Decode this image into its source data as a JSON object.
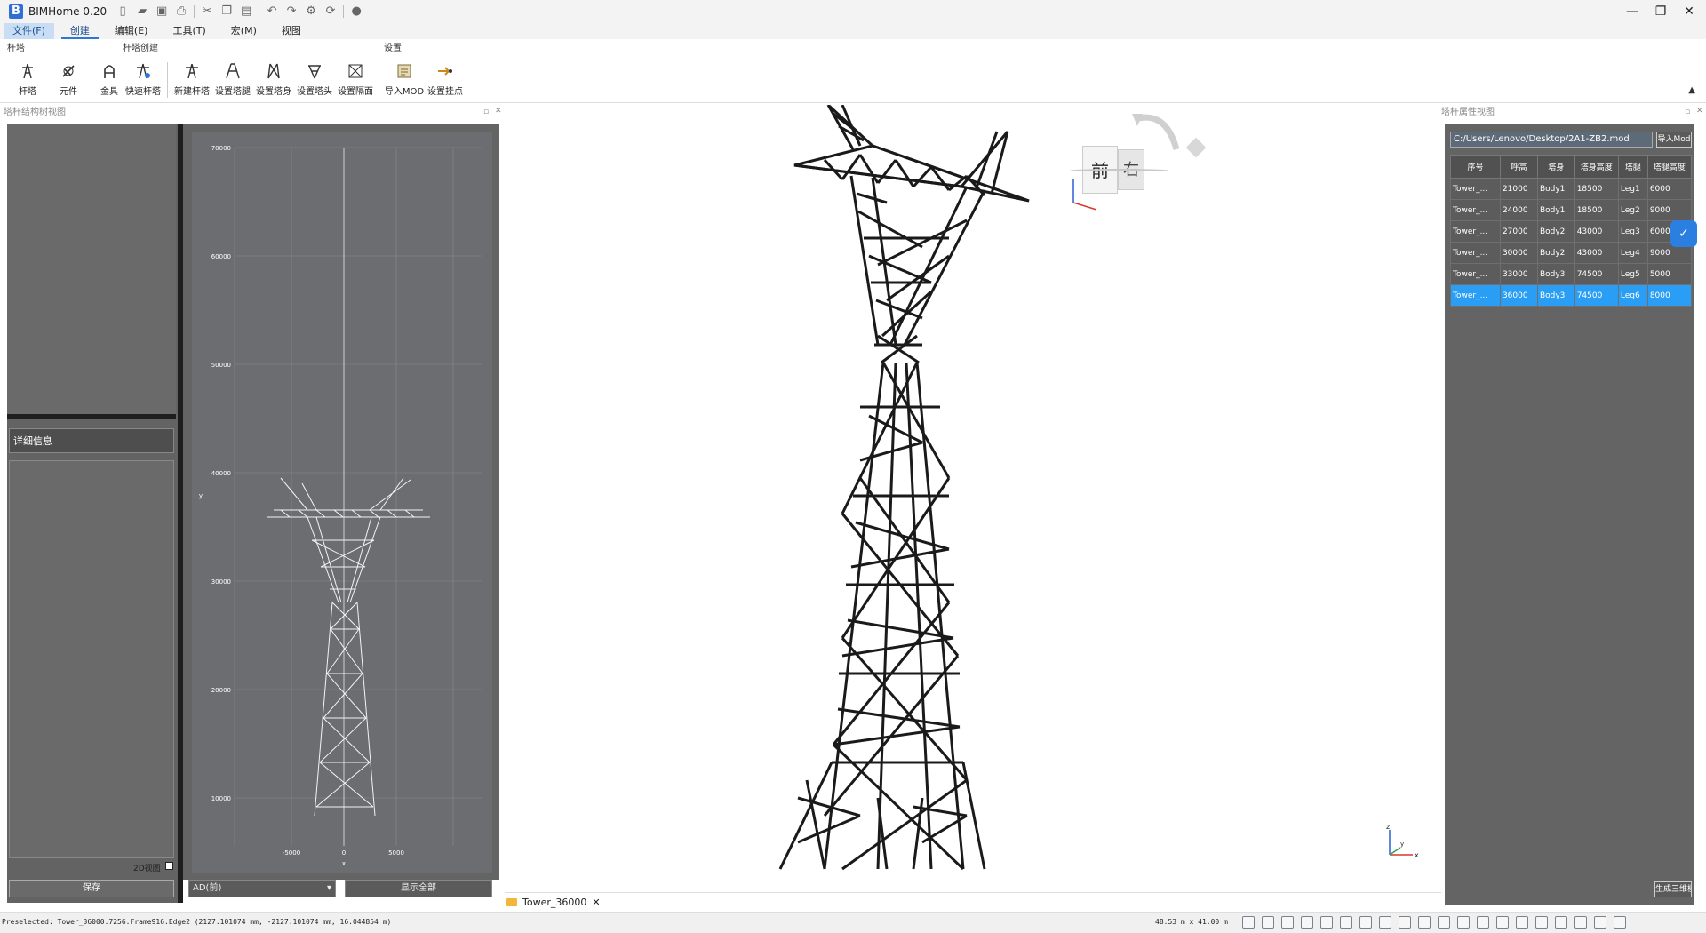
{
  "app": {
    "title": "BIMHome 0.20"
  },
  "menu": [
    "文件(F)",
    "创建",
    "编辑(E)",
    "工具(T)",
    "宏(M)",
    "视图"
  ],
  "ribbon": {
    "groups": [
      {
        "label": "杆塔",
        "buttons": [
          "杆塔",
          "元件",
          "金具"
        ]
      },
      {
        "label": "杆塔创建",
        "buttons": [
          "快速杆塔",
          "新建杆塔",
          "设置塔腿",
          "设置塔身",
          "设置塔头",
          "设置隔面"
        ]
      },
      {
        "label": "设置",
        "buttons": [
          "导入MOD",
          "设置挂点"
        ]
      }
    ]
  },
  "left_panel": {
    "title": "塔杆结构树视图",
    "detail_title": "详细信息",
    "view2d_label": "2D视图",
    "save_label": "保存",
    "view_select": "AD(前)",
    "show_all_label": "显示全部",
    "plot": {
      "y_ticks": [
        "70000",
        "60000",
        "50000",
        "40000",
        "30000",
        "20000",
        "10000"
      ],
      "x_ticks": [
        "-5000",
        "0",
        "5000"
      ],
      "xlabel": "x",
      "ylabel": "y"
    }
  },
  "viewport": {
    "tab_label": "Tower_36000",
    "cube_front": "前",
    "cube_right": "右",
    "axis_z": "z",
    "axis_x": "x",
    "axis_y": "y"
  },
  "right_panel": {
    "title": "塔杆属性视图",
    "path": "C:/Users/Lenovo/Desktop/2A1-ZB2.mod",
    "import_label": "导入Mod",
    "gen3d_label": "生成三维模型",
    "columns": [
      "序号",
      "呼高",
      "塔身",
      "塔身高度",
      "塔腿",
      "塔腿高度"
    ],
    "rows": [
      [
        "Tower_...",
        "21000",
        "Body1",
        "18500",
        "Leg1",
        "6000"
      ],
      [
        "Tower_...",
        "24000",
        "Body1",
        "18500",
        "Leg2",
        "9000"
      ],
      [
        "Tower_...",
        "27000",
        "Body2",
        "43000",
        "Leg3",
        "6000"
      ],
      [
        "Tower_...",
        "30000",
        "Body2",
        "43000",
        "Leg4",
        "9000"
      ],
      [
        "Tower_...",
        "33000",
        "Body3",
        "74500",
        "Leg5",
        "5000"
      ],
      [
        "Tower_...",
        "36000",
        "Body3",
        "74500",
        "Leg6",
        "8000"
      ]
    ],
    "selected_row": 5
  },
  "status": {
    "preselected": "Preselected: Tower_36000.7256.Frame916.Edge2 (2127.101074 mm, -2127.101074 mm, 16.044854 m)",
    "dimensions": "48.53 m x 41.00 m"
  },
  "colors": {
    "accent": "#2b78d6",
    "selection": "#2a9df4",
    "panel_dark": "#646464"
  }
}
